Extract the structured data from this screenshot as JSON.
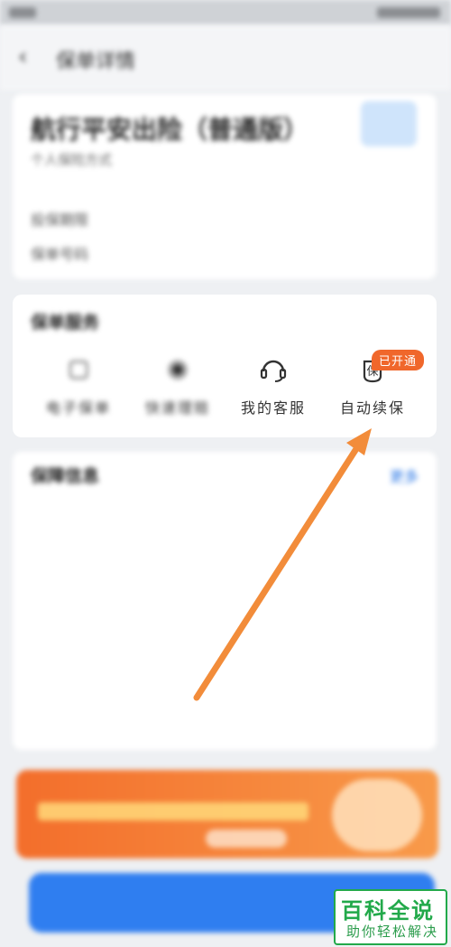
{
  "nav": {
    "back_icon": "back-arrow-icon",
    "title": "保单详情"
  },
  "policy": {
    "name": "航行平安出险（普通版）",
    "subtitle": "个人保险方式",
    "rows": [
      {
        "key": "投保期限",
        "value": ""
      },
      {
        "key": "保单号码",
        "value": ""
      }
    ]
  },
  "services": {
    "title": "保单服务",
    "items": [
      {
        "label": "电子保单",
        "icon": "document-icon"
      },
      {
        "label": "快速理赔",
        "icon": "claim-icon"
      },
      {
        "label": "我的客服",
        "icon": "headset-icon"
      },
      {
        "label": "自动续保",
        "icon": "shield-renew-icon"
      }
    ],
    "badge": "已开通"
  },
  "info": {
    "title": "保障信息",
    "more": "更多",
    "rows": [
      {
        "key": "",
        "value": ""
      },
      {
        "key": "",
        "value": ""
      },
      {
        "key": "",
        "value": ""
      },
      {
        "key": "",
        "value": ""
      },
      {
        "key": "",
        "value": ""
      },
      {
        "key": "",
        "value": ""
      }
    ]
  },
  "renew_button": "",
  "watermark": {
    "brand": "百科全说",
    "slogan": "助你轻松解决"
  },
  "colors": {
    "accent": "#f0672b",
    "primary": "#2f7ef0",
    "arrow": "#f28c3a"
  }
}
